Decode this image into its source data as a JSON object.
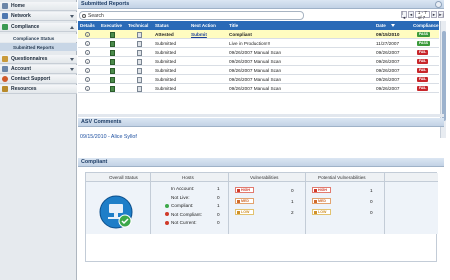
{
  "sidebar": {
    "items": [
      {
        "label": "Home"
      },
      {
        "label": "Network"
      },
      {
        "label": "Compliance"
      },
      {
        "label": "Questionnaires"
      },
      {
        "label": "Account"
      },
      {
        "label": "Contact Support"
      },
      {
        "label": "Resources"
      }
    ],
    "subitems": [
      {
        "label": "Compliance Status"
      },
      {
        "label": "Submitted Reports"
      }
    ]
  },
  "reports": {
    "title": "Submitted Reports",
    "search_label": "Search",
    "pager": {
      "prev_first": "|◄",
      "prev": "◄",
      "select": "1 - 7 of 7",
      "next": "►",
      "next_last": "►|"
    },
    "columns": [
      "Details",
      "Executive",
      "Technical",
      "Status",
      "Next Action",
      "Title",
      "Date",
      "Compliance"
    ],
    "rows": [
      {
        "status": "Attested",
        "action": "Submit",
        "title": "Compliant",
        "date": "09/15/2010",
        "compliance": "PASS"
      },
      {
        "status": "Submitted",
        "action": "",
        "title": "Live in Production!!!",
        "date": "11/27/2007",
        "compliance": "PASS"
      },
      {
        "status": "Submitted",
        "action": "",
        "title": "09/26/2007 Manual Scan",
        "date": "09/26/2007",
        "compliance": "FAIL"
      },
      {
        "status": "Submitted",
        "action": "",
        "title": "09/26/2007 Manual Scan",
        "date": "09/26/2007",
        "compliance": "FAIL"
      },
      {
        "status": "Submitted",
        "action": "",
        "title": "09/26/2007 Manual Scan",
        "date": "09/26/2007",
        "compliance": "FAIL"
      },
      {
        "status": "Submitted",
        "action": "",
        "title": "09/26/2007 Manual Scan",
        "date": "09/26/2007",
        "compliance": "FAIL"
      },
      {
        "status": "Submitted",
        "action": "",
        "title": "09/26/2007 Manual Scan",
        "date": "09/26/2007",
        "compliance": "FAIL"
      }
    ]
  },
  "comments": {
    "title": "ASV Comments",
    "text": "09/15/2010 - Alice Syllof"
  },
  "compliant": {
    "title": "Compliant",
    "headers": [
      "Overall Status",
      "Hosts",
      "Vulnerabilities",
      "Potential Vulnerabilities"
    ],
    "hosts": [
      {
        "label": "In Account:",
        "value": "1"
      },
      {
        "label": "Not Live:",
        "value": "0"
      },
      {
        "label": "Compliant:",
        "value": "1"
      },
      {
        "label": "Not Compliant:",
        "value": "0"
      },
      {
        "label": "Not Current:",
        "value": "0"
      }
    ],
    "vulns": [
      {
        "level": "HIGH",
        "value": "0"
      },
      {
        "level": "MED",
        "value": "1"
      },
      {
        "level": "LOW",
        "value": "2"
      }
    ],
    "potential": [
      {
        "level": "HIGH",
        "value": "1"
      },
      {
        "level": "MED",
        "value": "0"
      },
      {
        "level": "LOW",
        "value": "0"
      }
    ]
  },
  "colors": {
    "pass": "#3a9a3a",
    "fail": "#c8262b",
    "header": "#2a6ab7",
    "highlight": "#fffcc0"
  }
}
